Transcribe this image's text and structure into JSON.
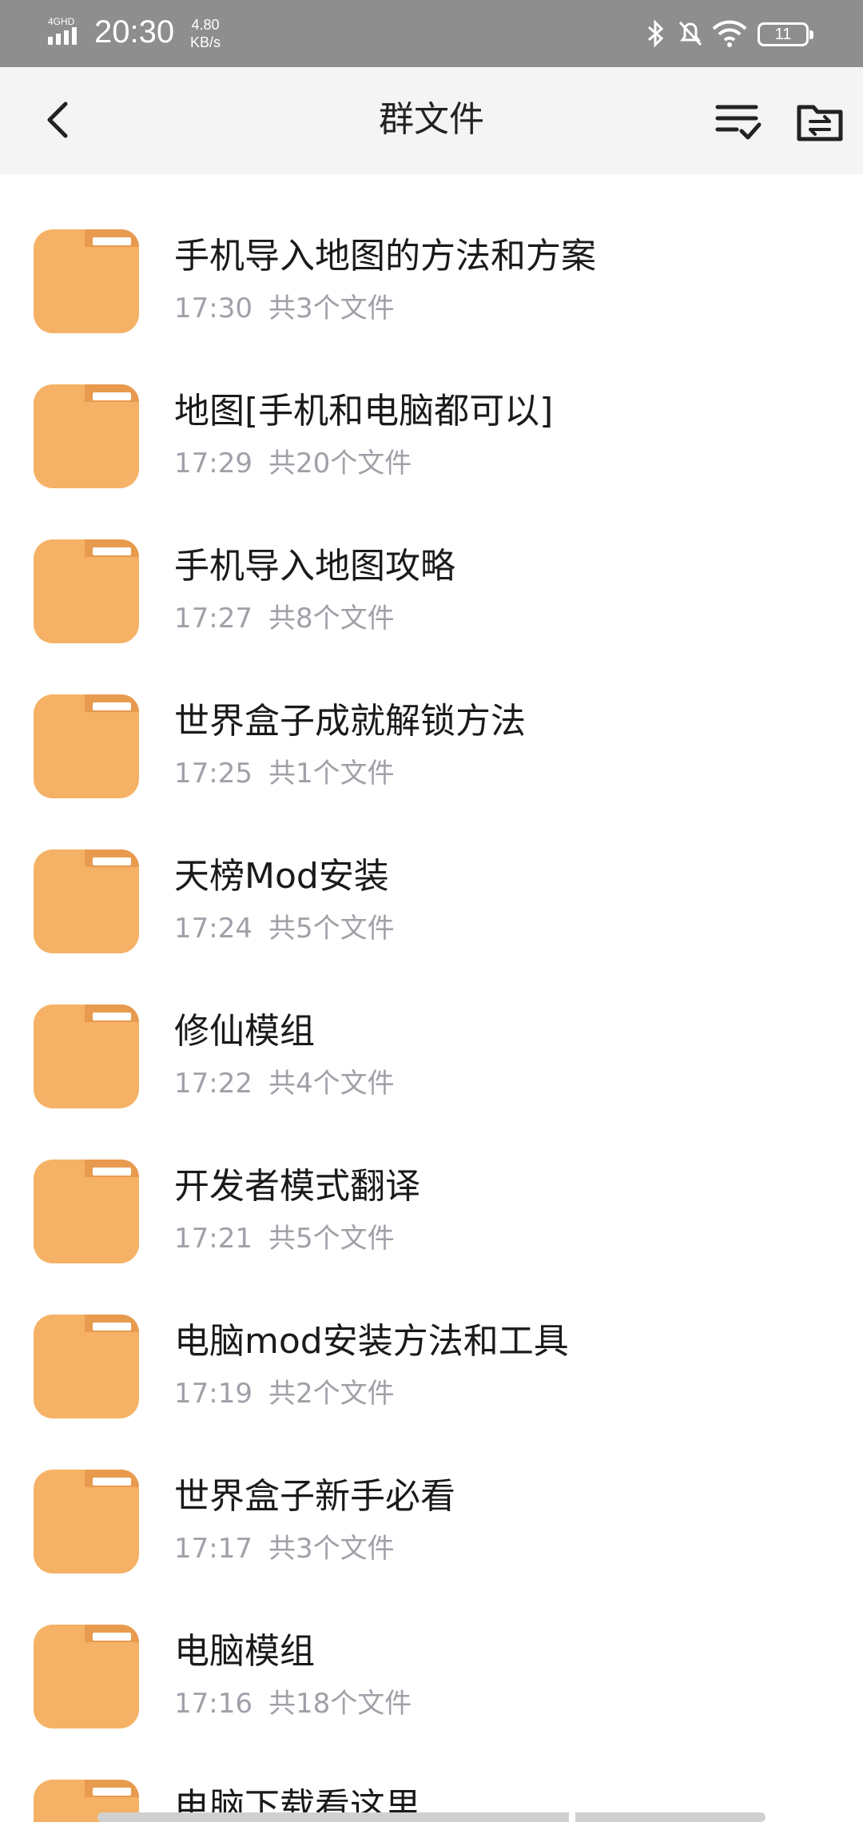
{
  "status_bar": {
    "network": "4GHD",
    "time": "20:30",
    "speed_value": "4.80",
    "speed_unit": "KB/s",
    "battery": "11"
  },
  "header": {
    "title": "群文件"
  },
  "partial_header_text": "",
  "folders": [
    {
      "name": "手机导入地图的方法和方案",
      "time": "17:30",
      "count": "共3个文件"
    },
    {
      "name": "地图[手机和电脑都可以]",
      "time": "17:29",
      "count": "共20个文件"
    },
    {
      "name": "手机导入地图攻略",
      "time": "17:27",
      "count": "共8个文件"
    },
    {
      "name": "世界盒子成就解锁方法",
      "time": "17:25",
      "count": "共1个文件"
    },
    {
      "name": "天榜Mod安装",
      "time": "17:24",
      "count": "共5个文件"
    },
    {
      "name": "修仙模组",
      "time": "17:22",
      "count": "共4个文件"
    },
    {
      "name": "开发者模式翻译",
      "time": "17:21",
      "count": "共5个文件"
    },
    {
      "name": "电脑mod安装方法和工具",
      "time": "17:19",
      "count": "共2个文件"
    },
    {
      "name": "世界盒子新手必看",
      "time": "17:17",
      "count": "共3个文件"
    },
    {
      "name": "电脑模组",
      "time": "17:16",
      "count": "共18个文件"
    },
    {
      "name": "电脑下载看这里",
      "time": "",
      "count": ""
    }
  ],
  "colors": {
    "status_bar_bg": "#8e8e8e",
    "title_bar_bg": "#f4f4f4",
    "folder_color": "#f5b266",
    "meta_text": "#a0a0a8"
  },
  "icons": {
    "back": "chevron-left-icon",
    "sort": "sort-check-icon",
    "folder_transfer": "folder-transfer-icon",
    "folder": "folder-icon"
  }
}
